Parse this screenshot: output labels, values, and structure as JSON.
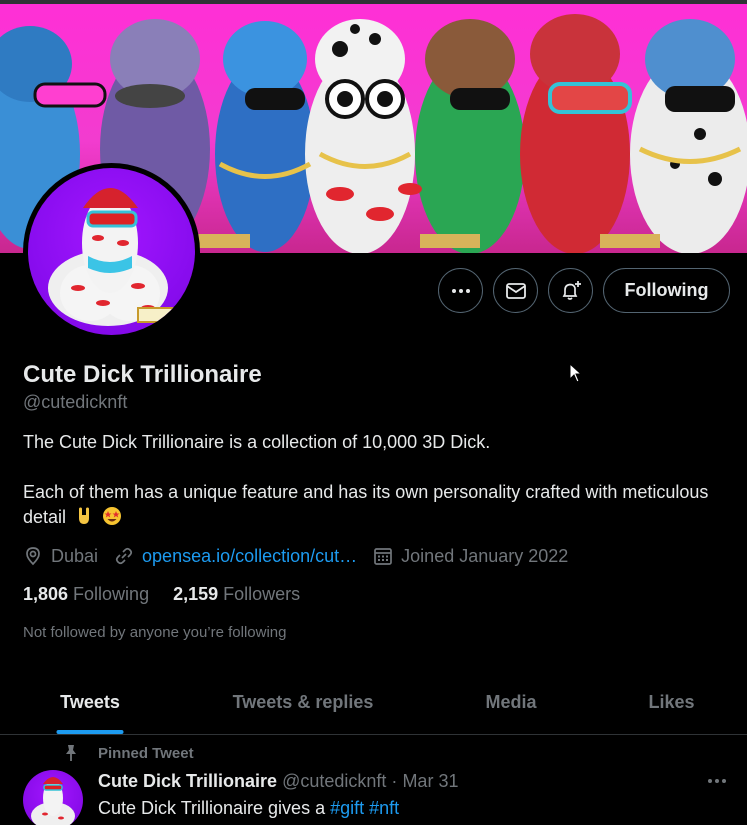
{
  "profile": {
    "name": "Cute Dick Trillionaire",
    "handle": "@cutedicknft",
    "bio_line1": "The Cute Dick Trillionaire is a collection of 10,000 3D Dick.",
    "bio_line2": "Each of them has a unique feature and has its own personality crafted with meticulous detail",
    "location": "Dubai",
    "website": "opensea.io/collection/cut…",
    "joined": "Joined January 2022",
    "following_count": "1,806",
    "following_label": "Following",
    "followers_count": "2,159",
    "followers_label": "Followers",
    "not_followed_note": "Not followed by anyone you’re following"
  },
  "actions": {
    "more": "more-icon",
    "message": "mail-icon",
    "notify": "bell-plus-icon",
    "following_button": "Following"
  },
  "tabs": [
    {
      "label": "Tweets",
      "active": true
    },
    {
      "label": "Tweets & replies",
      "active": false
    },
    {
      "label": "Media",
      "active": false
    },
    {
      "label": "Likes",
      "active": false
    }
  ],
  "pinned_tweet": {
    "pinned_label": "Pinned Tweet",
    "author_name": "Cute Dick Trillionaire",
    "author_handle": "@cutedicknft",
    "separator": "·",
    "date": "Mar 31",
    "text_prefix": "Cute Dick Trillionaire gives a",
    "hashtags": [
      "#gift",
      "#nft"
    ]
  },
  "colors": {
    "background": "#000000",
    "accent": "#1d9bf0",
    "muted": "#71767b",
    "text": "#e7e9ea",
    "banner": "#ff2fd6"
  }
}
